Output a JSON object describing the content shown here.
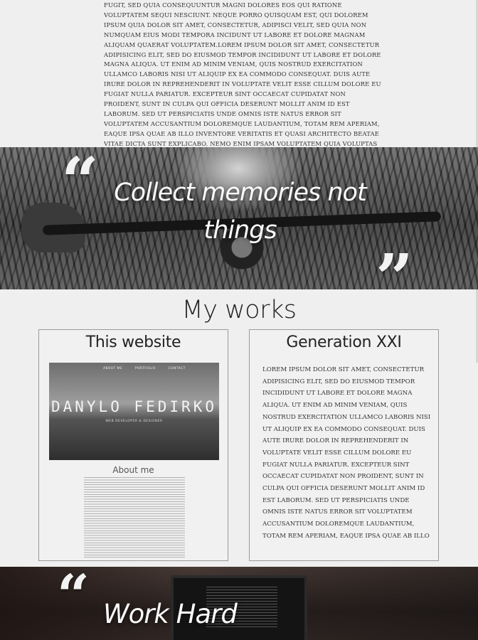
{
  "about": {
    "text": "fugit, sed quia consequuntur magni dolores eos qui ratione voluptatem sequi nesciunt. Neque porro quisquam est, qui dolorem ipsum quia dolor sit amet, consectetur, adipisci velit, sed quia non numquam eius modi tempora incidunt ut labore et dolore magnam aliquam quaerat voluptatem.Lorem ipsum dolor sit amet, consectetur adipisicing elit, sed do eiusmod tempor incididunt ut labore et dolore magna aliqua. Ut enim ad minim veniam, quis nostrud exercitation ullamco laboris nisi ut aliquip ex ea commodo consequat. Duis aute irure dolor in reprehenderit in voluptate velit esse cillum dolore eu fugiat nulla pariatur. Excepteur sint occaecat cupidatat non proident, sunt in culpa qui officia deserunt mollit anim id est laborum. Sed ut perspiciatis unde omnis iste natus error sit voluptatem accusantium doloremque laudantium, totam rem aperiam, eaque ipsa quae ab illo inventore veritatis et quasi architecto beatae vitae dicta sunt explicabo. Nemo enim ipsam voluptatem quia voluptas sit aspernatur aut odit aut fugit, sed quia consequuntur magni dolores eos qui ratione"
  },
  "banner1": {
    "quote": "Collect memories not things",
    "open_mark": "“",
    "close_mark": "”"
  },
  "works": {
    "title": "My works",
    "items": [
      {
        "title": "This website",
        "preview": {
          "nav": [
            "ABOUT ME",
            "PORTFOLIO",
            "CONTACT"
          ],
          "name": "DANYLO FEDIRKO",
          "subtitle": "WEB DEVELOPER & DESIGNER",
          "about_heading": "About me"
        }
      },
      {
        "title": "Generation XXI",
        "text": "Lorem ipsum dolor sit amet, consectetur adipisicing elit, sed do eiusmod tempor incididunt ut labore et dolore magna aliqua. Ut enim ad minim veniam, quis nostrud exercitation ullamco laboris nisi ut aliquip ex ea commodo consequat. Duis aute irure dolor in reprehenderit in voluptate velit esse cillum dolore eu fugiat nulla pariatur. Excepteur sint occaecat cupidatat non proident, sunt in culpa qui officia deserunt mollit anim id est laborum. Sed ut perspiciatis unde omnis iste natus error sit voluptatem accusantium doloremque laudantium, totam rem aperiam, eaque ipsa quae ab illo inventore veritatis et quasi architecto beatae vitae dicta sunt explicabo. Nemo enim ipsam voluptatem quia voluptas sit aspernatur aut odit aut fugit, sed quia consequuntur magni dolores eos qui ratione voluptatem sequi nesciunt. Neque porro quisquam est, qui"
      }
    ]
  },
  "banner2": {
    "quote": "Work Hard",
    "open_mark": "“"
  }
}
